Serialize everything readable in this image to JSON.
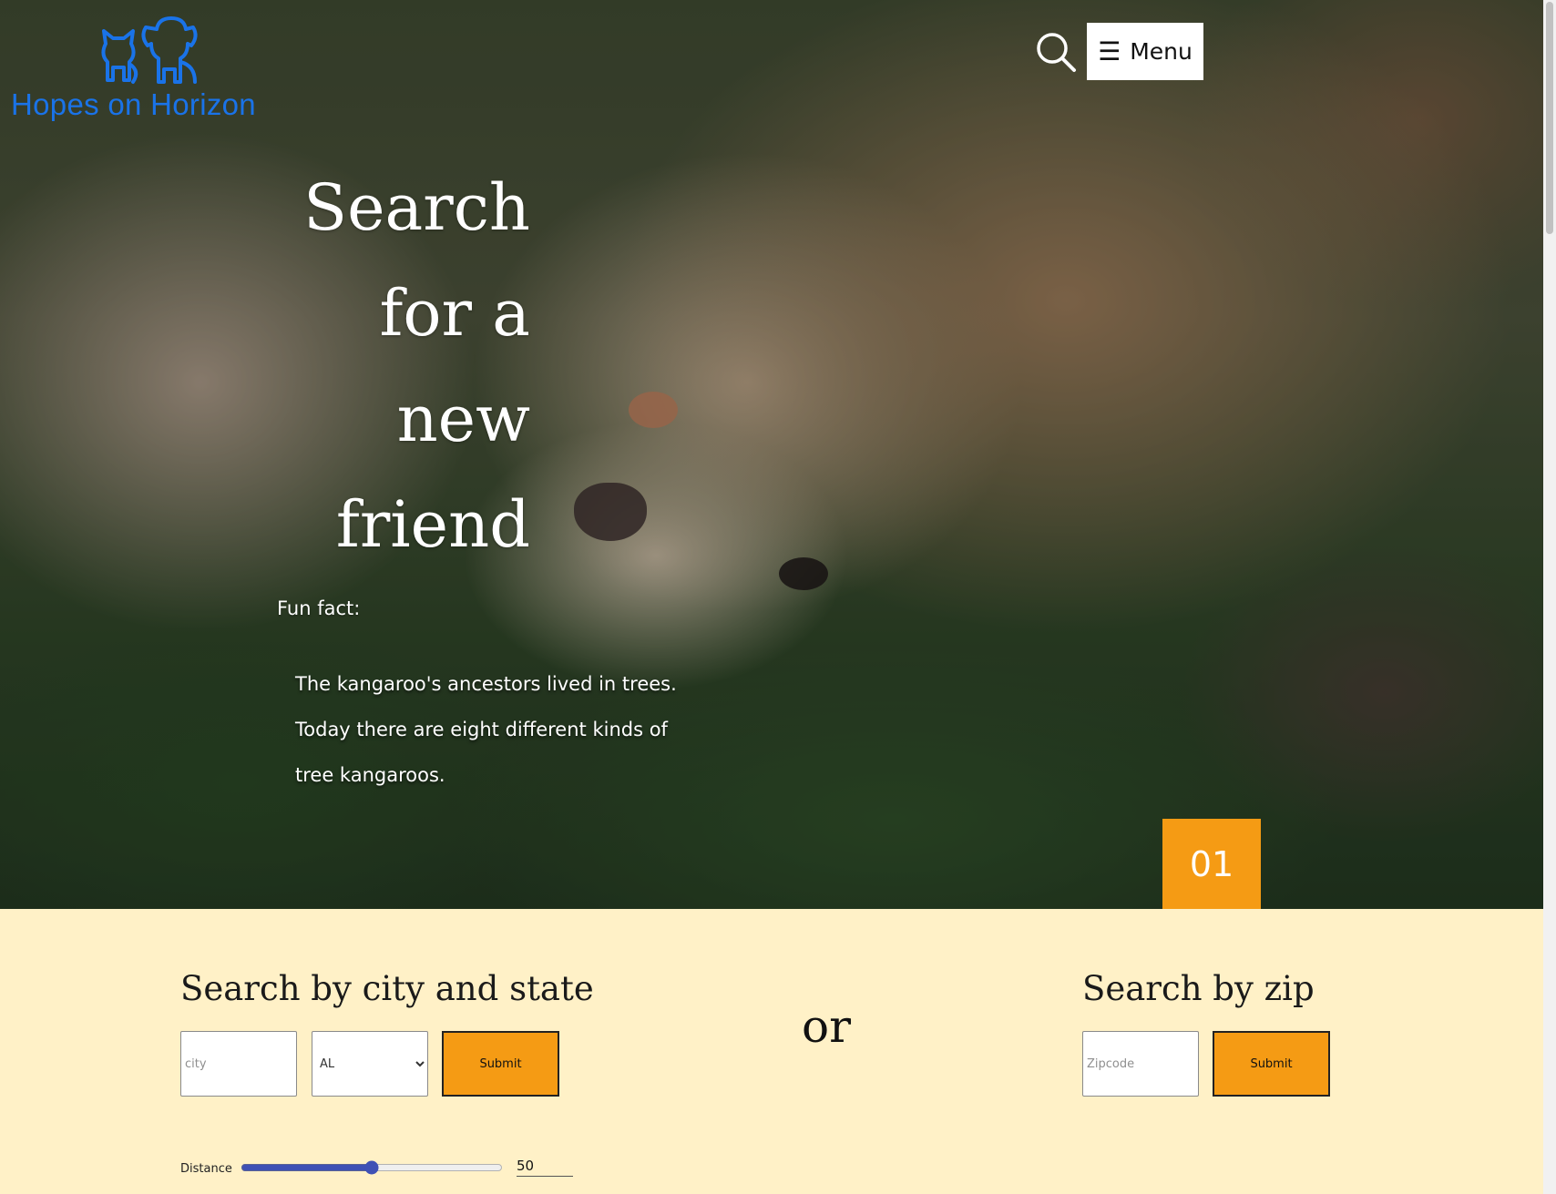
{
  "header": {
    "brand_name": "Hopes on Horizon",
    "brand_color": "#1a73e8",
    "search_icon": "search-icon",
    "menu_icon": "hamburger-icon",
    "menu_label": "Menu"
  },
  "hero": {
    "headline_lines": [
      "Search",
      "for a",
      "new",
      "friend"
    ],
    "fun_fact_label": "Fun fact:",
    "fun_fact_text": "The kangaroo's ancestors lived in trees. Today there are eight different kinds of tree kangaroos.",
    "slide_number": "01",
    "badge_color": "#f59b14"
  },
  "search": {
    "city_state_title": "Search by city and state",
    "city_placeholder": "city",
    "state_selected": "AL",
    "submit_label": "Submit",
    "or_label": "or",
    "zip_title": "Search by zip",
    "zip_placeholder": "Zipcode",
    "distance_label": "Distance",
    "distance_value": "50",
    "distance_min": 0,
    "distance_max": 100,
    "section_bg": "#fff1c7",
    "button_color": "#f59b14"
  }
}
